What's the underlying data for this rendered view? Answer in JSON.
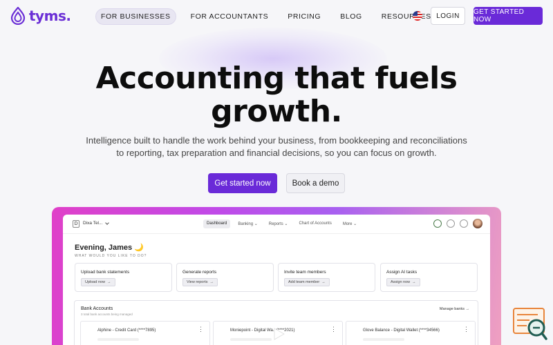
{
  "header": {
    "logo_text": "tyms.",
    "nav": [
      {
        "label": "FOR BUSINESSES",
        "active": true
      },
      {
        "label": "FOR ACCOUNTANTS",
        "active": false
      },
      {
        "label": "PRICING",
        "active": false
      },
      {
        "label": "BLOG",
        "active": false
      },
      {
        "label": "RESOURCES",
        "active": false,
        "has_dropdown": true
      }
    ],
    "language_flag_icon": "us-flag-icon",
    "login_label": "LOGIN",
    "cta_label": "GET STARTED NOW"
  },
  "hero": {
    "title_line1": "Accounting that fuels",
    "title_line2": "growth.",
    "subtitle_line1": "Intelligence built to handle the work behind your business, from bookkeeping and reconciliations",
    "subtitle_line2": "to reporting, tax preparation and financial decisions, so you can focus on growth.",
    "primary_button": "Get started now",
    "secondary_button": "Book a demo"
  },
  "app_preview": {
    "org_initial": "D",
    "org_name": "Dixa Tel...",
    "tabs": [
      {
        "label": "Dashboard",
        "active": true
      },
      {
        "label": "Banking",
        "active": false,
        "has_dropdown": true
      },
      {
        "label": "Reports",
        "active": false,
        "has_dropdown": true
      },
      {
        "label": "Chart of Accounts",
        "active": false
      },
      {
        "label": "More",
        "active": false,
        "has_dropdown": true
      }
    ],
    "greeting": "Evening, James 🌙",
    "prompt": "WHAT WOULD YOU LIKE TO DO?",
    "tasks": [
      {
        "title": "Upload bank statements",
        "button": "Upload now"
      },
      {
        "title": "Generate reports",
        "button": "View reports"
      },
      {
        "title": "Invite team members",
        "button": "Add team member"
      },
      {
        "title": "Assign AI tasks",
        "button": "Assign now"
      }
    ],
    "bank_section": {
      "title": "Bank Accounts",
      "subtitle": "3 total bank accounts being managed",
      "manage_label": "Manage banks",
      "accounts": [
        {
          "name": "Alphine - Credit Card (****7895)"
        },
        {
          "name": "Moniepoint - Digital Wa...(****2021)"
        },
        {
          "name": "Glove Balance - Digital Wallet (****34566)"
        }
      ]
    }
  },
  "colors": {
    "brand": "#6a2ad8",
    "background": "#f6f6f9"
  }
}
